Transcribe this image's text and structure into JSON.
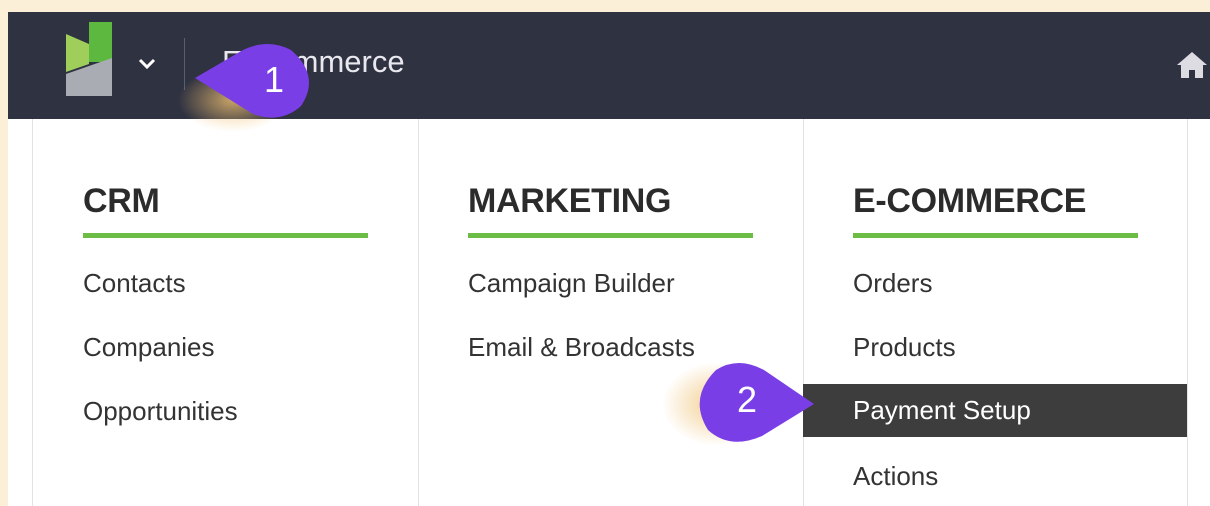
{
  "header": {
    "app_title": "E-Commerce",
    "colors": {
      "bar": "#2f3241",
      "brand_green": "#6bbd45"
    },
    "icons": [
      "logo-icon",
      "chevron-down-icon",
      "home-icon"
    ]
  },
  "menu": {
    "columns": [
      {
        "title": "CRM",
        "items": [
          "Contacts",
          "Companies",
          "Opportunities"
        ]
      },
      {
        "title": "MARKETING",
        "items": [
          "Campaign Builder",
          "Email & Broadcasts"
        ]
      },
      {
        "title": "E-COMMERCE",
        "items": [
          "Orders",
          "Products",
          "Payment Setup",
          "Actions"
        ],
        "active_item": "Payment Setup"
      }
    ]
  },
  "callouts": [
    {
      "number": "1"
    },
    {
      "number": "2"
    }
  ]
}
